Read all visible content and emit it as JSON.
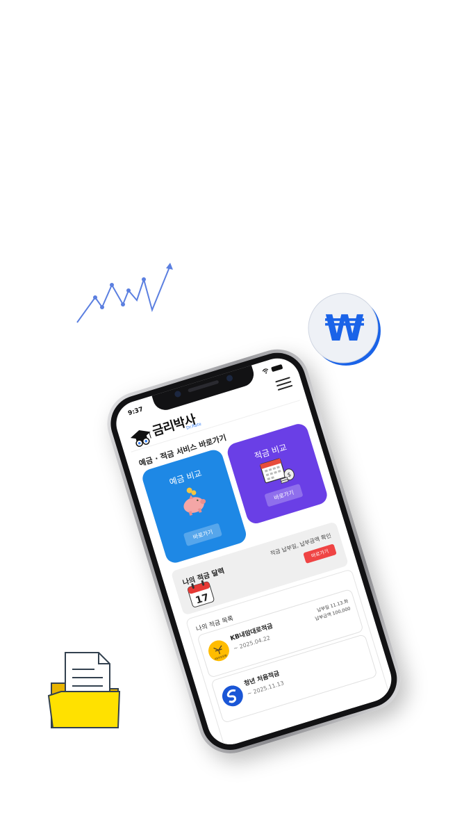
{
  "status": {
    "time": "9:37"
  },
  "header": {
    "logo_text": "금리박사",
    "logo_sub": "Dr.Rate"
  },
  "section": {
    "title": "예금 · 적금 서비스 바로가기"
  },
  "cards": {
    "deposit": {
      "title": "예금 비교",
      "button": "바로가기"
    },
    "savings": {
      "title": "적금 비교",
      "button": "바로가기"
    }
  },
  "calendar_banner": {
    "title": "나의 적금 달력",
    "description": "적금 납부일, 납부금액 확인",
    "button": "바로가기",
    "icon_day": "17"
  },
  "savings_list": {
    "title": "나의 적금 목록",
    "items": [
      {
        "name": "KB내맘대로적금",
        "date": "~ 2025.04.22",
        "pay_day": "납부일 11.13.화",
        "pay_amount": "납부금액 100,000",
        "logo_text": "KB국민은행"
      },
      {
        "name": "청년 처음적금",
        "date": "~ 2025.11.13"
      }
    ]
  },
  "decorations": {
    "currency_symbol": "₩"
  },
  "colors": {
    "deposit_card": "#1e88e5",
    "savings_card": "#6a3fe6",
    "accent_red": "#ef4444",
    "chart_line": "#5b7fe0",
    "won_blue": "#1a63e8"
  },
  "icons": [
    "trend-line-icon",
    "won-coin-icon",
    "folder-document-icon",
    "piggy-bank-icon",
    "calendar-money-icon",
    "calendar-17-icon",
    "kb-bank-logo",
    "shinhan-bank-logo",
    "graduation-cap-logo",
    "menu-icon"
  ]
}
